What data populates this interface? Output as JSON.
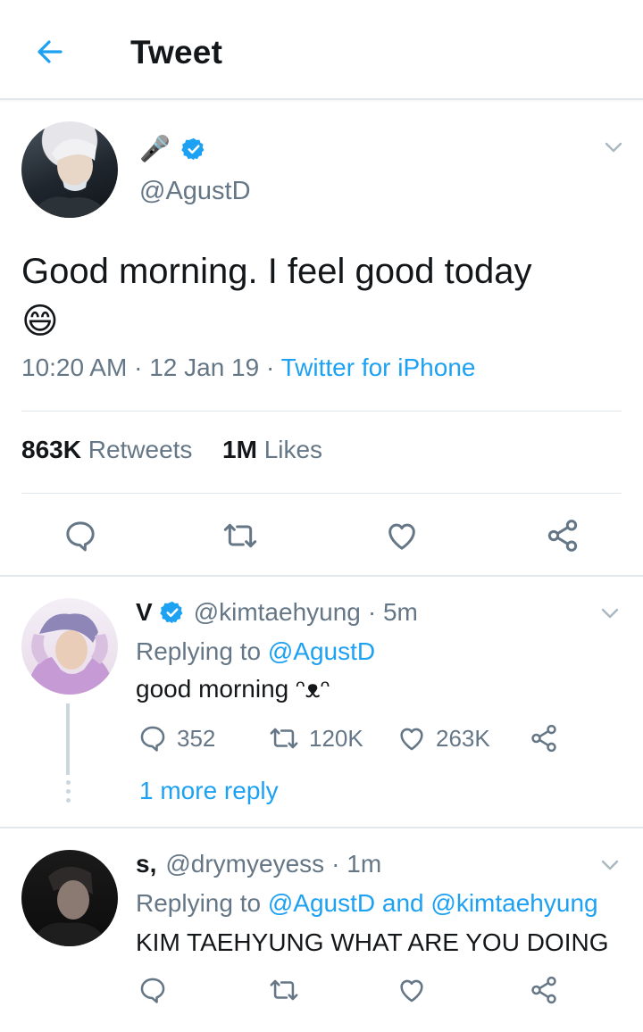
{
  "header": {
    "title": "Tweet"
  },
  "main_tweet": {
    "display_name_emoji": "🎤",
    "handle": "@AgustD",
    "text_line1": "Good morning. I feel good today",
    "emoji": "😄",
    "time": "10:20 AM",
    "sep1": "·",
    "date": "12 Jan 19",
    "sep2": "·",
    "source": "Twitter for iPhone",
    "retweet_count": "863K",
    "retweet_label": "Retweets",
    "like_count": "1M",
    "like_label": "Likes"
  },
  "replies": [
    {
      "name": "V",
      "handle": "@kimtaehyung",
      "time": "· 5m",
      "replying_prefix": "Replying to",
      "replying_to": "@AgustD",
      "text": "good morning ᵔᴥᵔ",
      "reply_count": "352",
      "retweet_count": "120K",
      "like_count": "263K",
      "more_reply": "1 more reply"
    },
    {
      "name": "s,",
      "handle": "@drymyeyess",
      "time": "· 1m",
      "replying_prefix": "Replying to",
      "replying_to": "@AgustD",
      "replying_and": "and",
      "replying_to_2": "@kimtaehyung",
      "text": "KIM TAEHYUNG WHAT ARE YOU DOING"
    }
  ],
  "colors": {
    "accent": "#1da1f2",
    "gray": "#657786",
    "divider": "#e1e8ed",
    "text": "#14171a"
  },
  "icons": [
    "back-arrow-icon",
    "chevron-down-icon",
    "verified-badge-icon",
    "reply-icon",
    "retweet-icon",
    "like-icon",
    "share-icon"
  ]
}
